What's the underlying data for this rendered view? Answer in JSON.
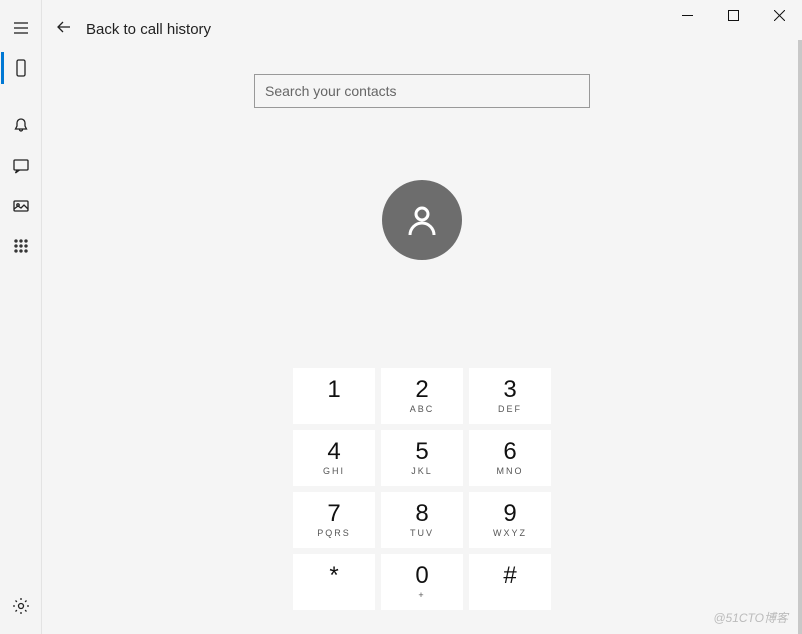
{
  "window": {
    "minimize": "–",
    "maximize": "□",
    "close": "×"
  },
  "back": {
    "label": "Back to call history"
  },
  "search": {
    "placeholder": "Search your contacts",
    "value": ""
  },
  "dialpad": [
    {
      "digit": "1",
      "letters": ""
    },
    {
      "digit": "2",
      "letters": "ABC"
    },
    {
      "digit": "3",
      "letters": "DEF"
    },
    {
      "digit": "4",
      "letters": "GHI"
    },
    {
      "digit": "5",
      "letters": "JKL"
    },
    {
      "digit": "6",
      "letters": "MNO"
    },
    {
      "digit": "7",
      "letters": "PQRS"
    },
    {
      "digit": "8",
      "letters": "TUV"
    },
    {
      "digit": "9",
      "letters": "WXYZ"
    },
    {
      "digit": "*",
      "letters": ""
    },
    {
      "digit": "0",
      "letters": "+"
    },
    {
      "digit": "#",
      "letters": ""
    }
  ],
  "watermark": "@51CTO博客"
}
